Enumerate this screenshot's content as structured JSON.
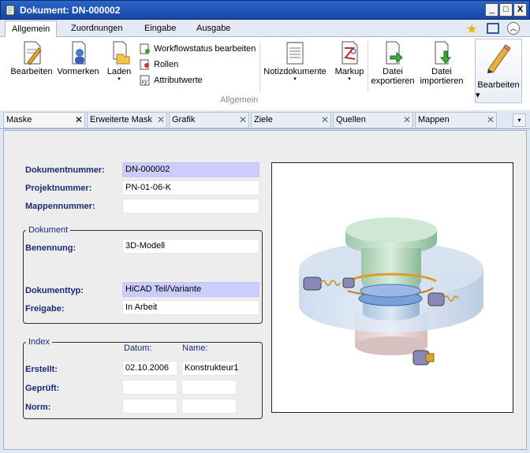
{
  "window": {
    "title": "Dokument: DN-000002",
    "buttons": [
      "_",
      "□",
      "X"
    ]
  },
  "ribbon": {
    "tabs": [
      "Allgemein",
      "Zuordnungen",
      "Eingabe",
      "Ausgabe"
    ],
    "active_tab": "Allgemein",
    "group_label": "Allgemein",
    "buttons": {
      "bearbeiten": "Bearbeiten",
      "vormerken": "Vormerken",
      "laden": "Laden",
      "workflow": "Workflowstatus bearbeiten",
      "rollen": "Rollen",
      "attribute": "Attributwerte",
      "notiz": "Notizdokumente",
      "markup": "Markup",
      "datei_exp_1": "Datei",
      "datei_exp_2": "exportieren",
      "datei_imp_1": "Datei",
      "datei_imp_2": "importieren",
      "bearbeiten_right": "Bearbeiten"
    },
    "dropdown_glyph": "▾"
  },
  "doc_tabs": [
    "Maske",
    "Erweiterte Mask",
    "Grafik",
    "Ziele",
    "Quellen",
    "Mappen"
  ],
  "doc_tab_close": "✕",
  "form": {
    "dokumentnummer_label": "Dokumentnummer:",
    "dokumentnummer": "DN-000002",
    "projektnummer_label": "Projektnummer:",
    "projektnummer": "PN-01-06-K",
    "mappennummer_label": "Mappennummer:",
    "mappennummer": "",
    "dokument_group": "Dokument",
    "benennung_label": "Benennung:",
    "benennung": "3D-Modell",
    "dokumenttyp_label": "Dokumenttyp:",
    "dokumenttyp": "HiCAD Teil/Variante",
    "freigabe_label": "Freigabe:",
    "freigabe": "In Arbeit",
    "index_group": "Index",
    "datum_header": "Datum:",
    "name_header": "Name:",
    "erstellt_label": "Erstellt:",
    "erstellt_datum": "02.10.2006",
    "erstellt_name": "Konstrukteur1",
    "geprueft_label": "Geprüft:",
    "geprueft_datum": "",
    "geprueft_name": "",
    "norm_label": "Norm:",
    "norm_datum": "",
    "norm_name": ""
  },
  "colors": {
    "highlight_field": "#ccccff",
    "label": "#1a2a7a",
    "titlebar": "#1f55b8"
  }
}
